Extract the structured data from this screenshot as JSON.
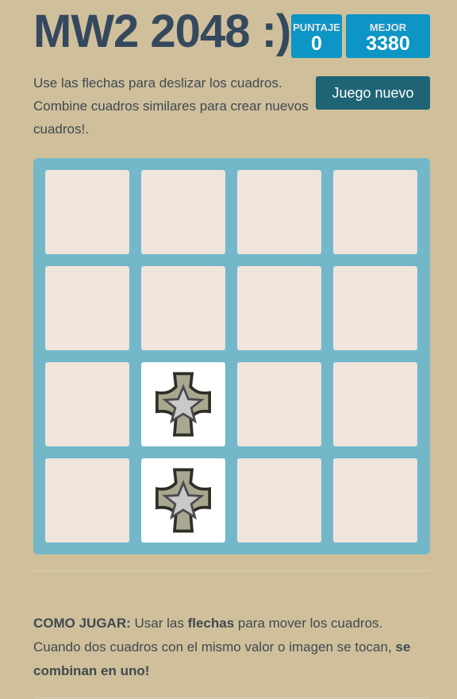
{
  "title": "MW2 2048 :)",
  "score": {
    "label": "PUNTAJE",
    "value": "0"
  },
  "best": {
    "label": "MEJOR",
    "value": "3380"
  },
  "intro": "Use las flechas para deslizar los cuadros. Combine cuadros similares para crear nuevos cuadros!.",
  "new_game": "Juego nuevo",
  "board": {
    "rows": 4,
    "cols": 4,
    "tiles": [
      {
        "row": 3,
        "col": 2,
        "image": "silver-star-cross-medal-icon"
      },
      {
        "row": 4,
        "col": 2,
        "image": "silver-star-cross-medal-icon"
      }
    ]
  },
  "how": {
    "heading": "COMO JUGAR:",
    "t1": " Usar las ",
    "bold1": "flechas",
    "t2": " para mover los cuadros. Cuando dos cuadros con el mismo valor o imagen se tocan, ",
    "bold2": "se combinan en uno!"
  },
  "colors": {
    "background": "#cfbf9b",
    "board": "#73b7c9",
    "score": "#0d95c5",
    "button": "#1e6475"
  }
}
